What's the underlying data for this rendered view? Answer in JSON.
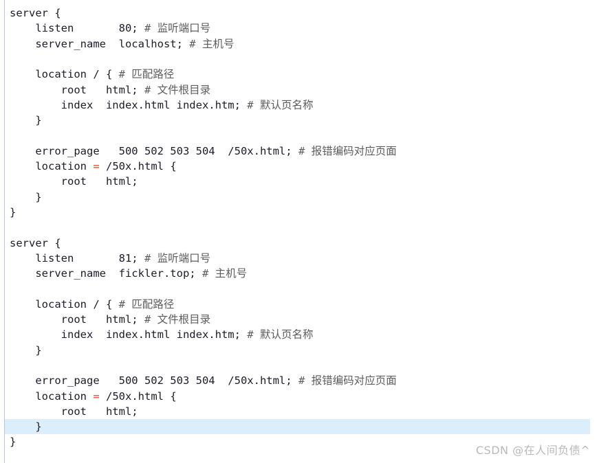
{
  "editor": {
    "language": "nginx-conf",
    "background_color": "#ffffff",
    "code_color": "#1b1b2b",
    "comment_color": "#5c5c5c",
    "operator_color": "#e03a21",
    "current_line_highlight_color": "#ddeefb",
    "gutter_rule_color": "#b9c6d8",
    "current_line_index": 27
  },
  "watermark": {
    "text": "CSDN @在人间负债^",
    "color": "#b9b9b9"
  },
  "lines": [
    {
      "indent": 0,
      "segments": [
        {
          "type": "code",
          "text": "server {"
        }
      ]
    },
    {
      "indent": 0,
      "segments": [
        {
          "type": "code",
          "text": "    listen       80; "
        },
        {
          "type": "comment",
          "text": "# 监听端口号"
        }
      ]
    },
    {
      "indent": 0,
      "segments": [
        {
          "type": "code",
          "text": "    server_name  localhost; "
        },
        {
          "type": "comment",
          "text": "# 主机号"
        }
      ]
    },
    {
      "indent": 0,
      "segments": [
        {
          "type": "code",
          "text": ""
        }
      ]
    },
    {
      "indent": 0,
      "segments": [
        {
          "type": "code",
          "text": "    location / { "
        },
        {
          "type": "comment",
          "text": "# 匹配路径"
        }
      ]
    },
    {
      "indent": 0,
      "segments": [
        {
          "type": "code",
          "text": "        root   html; "
        },
        {
          "type": "comment",
          "text": "# 文件根目录"
        }
      ]
    },
    {
      "indent": 0,
      "segments": [
        {
          "type": "code",
          "text": "        index  index.html index.htm; "
        },
        {
          "type": "comment",
          "text": "# 默认页名称"
        }
      ]
    },
    {
      "indent": 0,
      "segments": [
        {
          "type": "code",
          "text": "    }"
        }
      ]
    },
    {
      "indent": 0,
      "segments": [
        {
          "type": "code",
          "text": ""
        }
      ]
    },
    {
      "indent": 0,
      "segments": [
        {
          "type": "code",
          "text": "    error_page   500 502 503 504  /50x.html; "
        },
        {
          "type": "comment",
          "text": "# 报错编码对应页面"
        }
      ]
    },
    {
      "indent": 0,
      "segments": [
        {
          "type": "code",
          "text": "    location "
        },
        {
          "type": "op",
          "text": "="
        },
        {
          "type": "code",
          "text": " /50x.html {"
        }
      ]
    },
    {
      "indent": 0,
      "segments": [
        {
          "type": "code",
          "text": "        root   html;"
        }
      ]
    },
    {
      "indent": 0,
      "segments": [
        {
          "type": "code",
          "text": "    }"
        }
      ]
    },
    {
      "indent": 0,
      "segments": [
        {
          "type": "code",
          "text": "}"
        }
      ]
    },
    {
      "indent": 0,
      "segments": [
        {
          "type": "code",
          "text": ""
        }
      ]
    },
    {
      "indent": 0,
      "segments": [
        {
          "type": "code",
          "text": "server {"
        }
      ]
    },
    {
      "indent": 0,
      "segments": [
        {
          "type": "code",
          "text": "    listen       81; "
        },
        {
          "type": "comment",
          "text": "# 监听端口号"
        }
      ]
    },
    {
      "indent": 0,
      "segments": [
        {
          "type": "code",
          "text": "    server_name  fickler.top; "
        },
        {
          "type": "comment",
          "text": "# 主机号"
        }
      ]
    },
    {
      "indent": 0,
      "segments": [
        {
          "type": "code",
          "text": ""
        }
      ]
    },
    {
      "indent": 0,
      "segments": [
        {
          "type": "code",
          "text": "    location / { "
        },
        {
          "type": "comment",
          "text": "# 匹配路径"
        }
      ]
    },
    {
      "indent": 0,
      "segments": [
        {
          "type": "code",
          "text": "        root   html; "
        },
        {
          "type": "comment",
          "text": "# 文件根目录"
        }
      ]
    },
    {
      "indent": 0,
      "segments": [
        {
          "type": "code",
          "text": "        index  index.html index.htm; "
        },
        {
          "type": "comment",
          "text": "# 默认页名称"
        }
      ]
    },
    {
      "indent": 0,
      "segments": [
        {
          "type": "code",
          "text": "    }"
        }
      ]
    },
    {
      "indent": 0,
      "segments": [
        {
          "type": "code",
          "text": ""
        }
      ]
    },
    {
      "indent": 0,
      "segments": [
        {
          "type": "code",
          "text": "    error_page   500 502 503 504  /50x.html; "
        },
        {
          "type": "comment",
          "text": "# 报错编码对应页面"
        }
      ]
    },
    {
      "indent": 0,
      "segments": [
        {
          "type": "code",
          "text": "    location "
        },
        {
          "type": "op",
          "text": "="
        },
        {
          "type": "code",
          "text": " /50x.html {"
        }
      ]
    },
    {
      "indent": 0,
      "segments": [
        {
          "type": "code",
          "text": "        root   html;"
        }
      ]
    },
    {
      "indent": 0,
      "segments": [
        {
          "type": "code",
          "text": "    }"
        }
      ]
    },
    {
      "indent": 0,
      "segments": [
        {
          "type": "code",
          "text": "}"
        }
      ]
    }
  ]
}
